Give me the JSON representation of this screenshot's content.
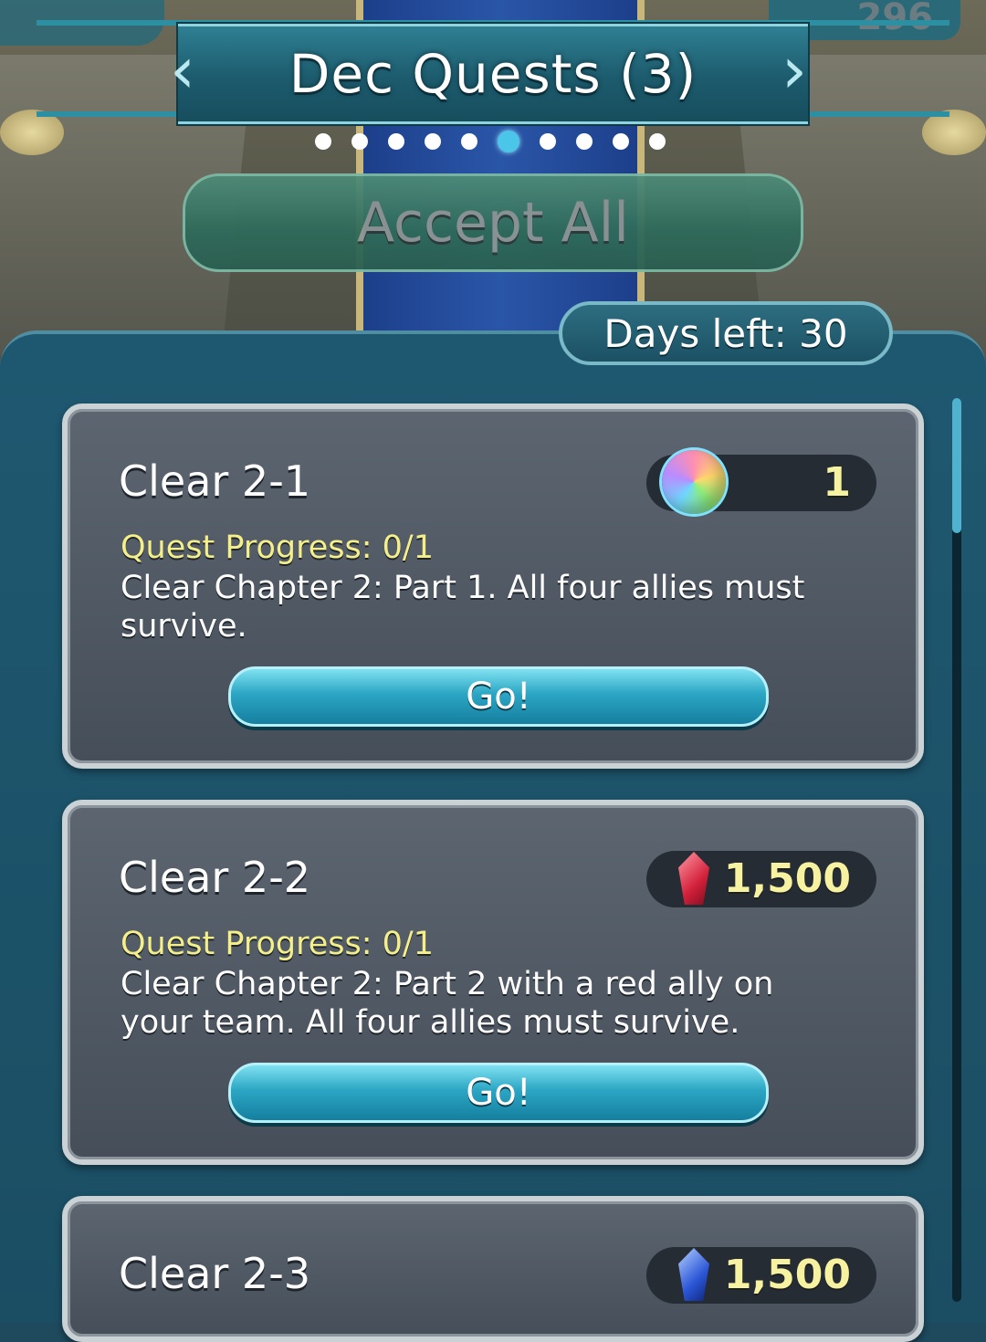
{
  "header": {
    "title": "Dec Quests (3)",
    "currency_value": "296",
    "page_dots": {
      "count": 10,
      "active_index": 5
    }
  },
  "accept_all_label": "Accept All",
  "days_left_label": "Days left: 30",
  "quests": [
    {
      "title": "Clear 2-1",
      "reward": {
        "icon": "orb-icon",
        "amount": "1"
      },
      "progress": "Quest Progress: 0/1",
      "description": "Clear Chapter 2: Part 1. All four allies must survive.",
      "button_label": "Go!"
    },
    {
      "title": "Clear 2-2",
      "reward": {
        "icon": "red-crystal-icon",
        "amount": "1,500"
      },
      "progress": "Quest Progress: 0/1",
      "description": "Clear Chapter 2: Part 2 with a red ally on your team. All four allies must survive.",
      "button_label": "Go!"
    },
    {
      "title": "Clear 2-3",
      "reward": {
        "icon": "blue-crystal-icon",
        "amount": "1,500"
      }
    }
  ],
  "colors": {
    "accent": "#49c6ea",
    "progress_text": "#f5ef8a",
    "reward_text": "#f6f2a0"
  }
}
